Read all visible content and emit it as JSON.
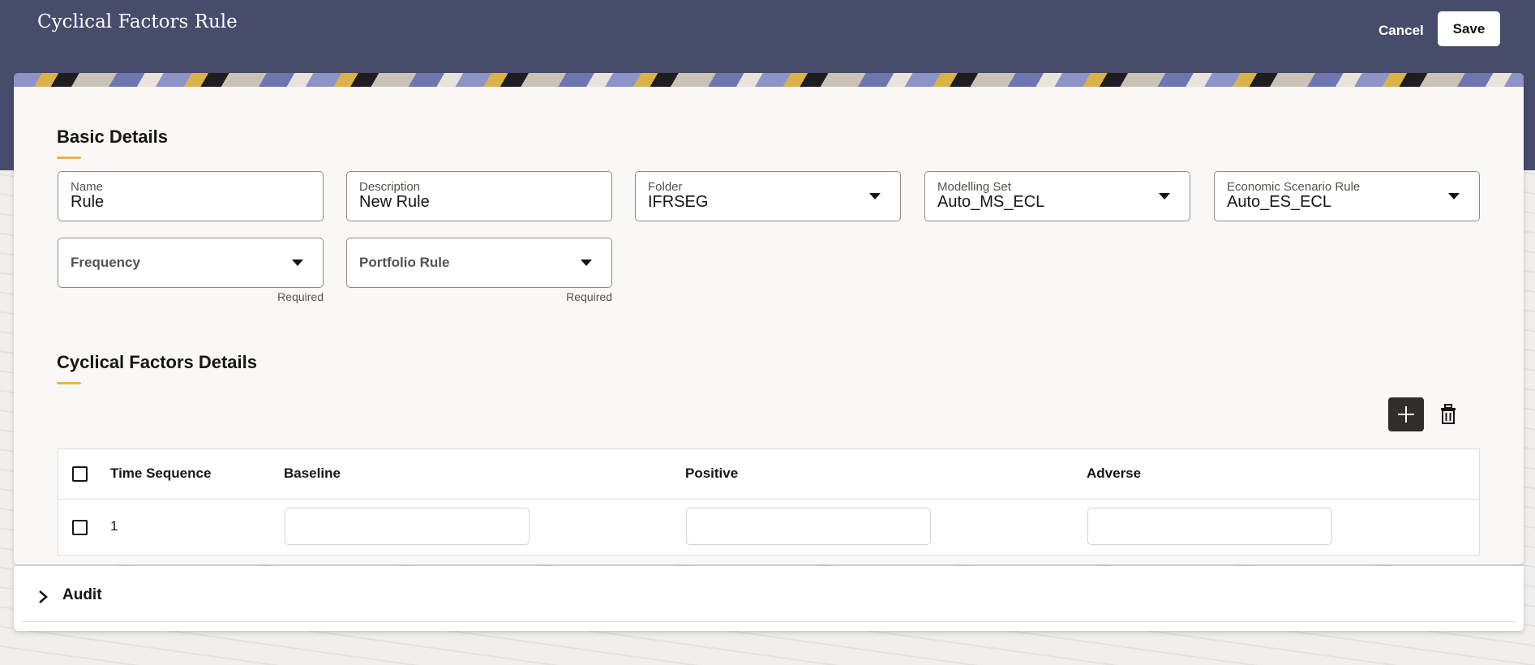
{
  "header": {
    "title": "Cyclical Factors Rule",
    "cancel_label": "Cancel",
    "save_label": "Save"
  },
  "basic_details": {
    "title": "Basic Details",
    "fields": [
      {
        "label": "Name",
        "value": "Rule"
      },
      {
        "label": "Description",
        "value": "New Rule"
      },
      {
        "label": "Folder",
        "value": "IFRSEG"
      },
      {
        "label": "Modelling Set",
        "value": "Auto_MS_ECL"
      },
      {
        "label": "Economic Scenario Rule",
        "value": "Auto_ES_ECL"
      }
    ],
    "frequency": {
      "placeholder": "Frequency",
      "helper": "Required"
    },
    "portfolio_rule": {
      "placeholder": "Portfolio Rule",
      "helper": "Required"
    }
  },
  "cyclical_details": {
    "title": "Cyclical Factors Details",
    "columns": [
      "Time Sequence",
      "Baseline",
      "Positive",
      "Adverse"
    ],
    "rows": [
      {
        "time_sequence": "1",
        "baseline": "",
        "positive": "",
        "adverse": ""
      }
    ]
  },
  "audit": {
    "label": "Audit"
  },
  "colors": {
    "header_bg": "#474c6b",
    "accent": "#e6b34a",
    "add_button_bg": "#312d2a"
  },
  "icons": [
    "plus-icon",
    "trash-icon",
    "chevron-right-icon",
    "caret-down-icon"
  ]
}
